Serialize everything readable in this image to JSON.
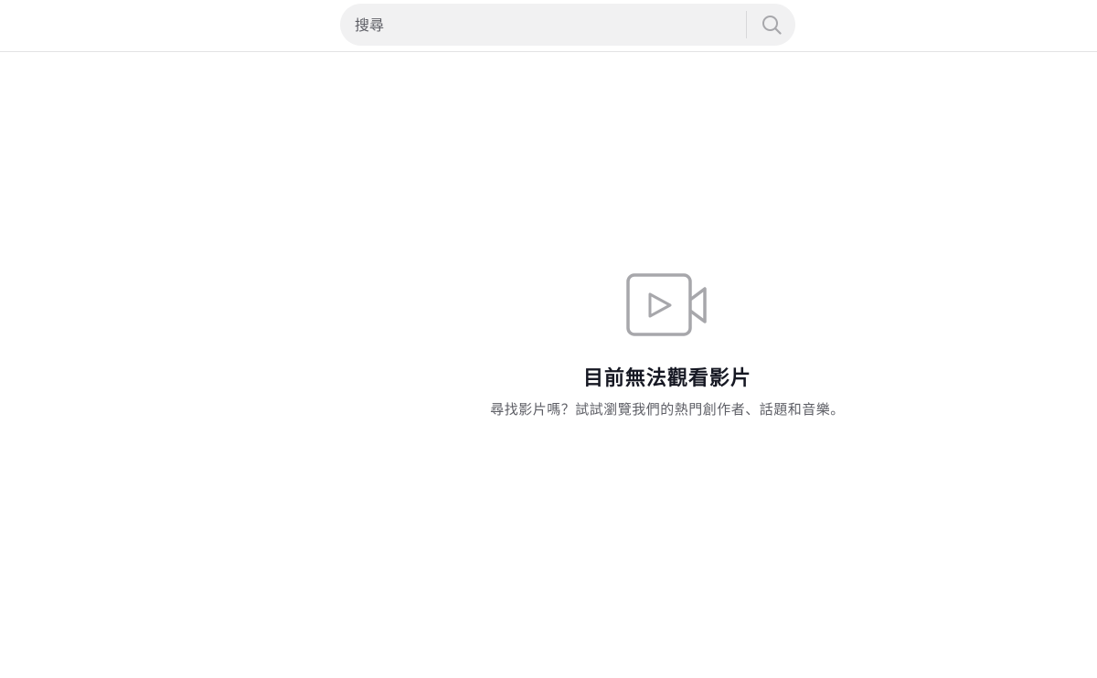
{
  "header": {
    "search": {
      "placeholder": "搜尋",
      "value": "",
      "button_icon": "search-icon"
    }
  },
  "empty_state": {
    "icon": "video-camera-icon",
    "title": "目前無法觀看影片",
    "subtitle": "尋找影片嗎？試試瀏覽我們的熱門創作者、話題和音樂。"
  },
  "colors": {
    "search_bg": "#f1f1f2",
    "icon_gray": "#a7a7ab",
    "title_text": "#161823",
    "subtitle_text": "#5e5f66"
  }
}
